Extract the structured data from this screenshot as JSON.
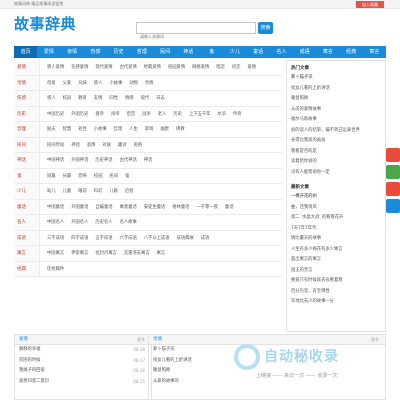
{
  "topbar": {
    "text": "故事词典 精品故事阅读鉴赏",
    "join": "加入收藏"
  },
  "logo": "故事辞典",
  "search": {
    "placeholder": "请输入关键词",
    "button": "搜索"
  },
  "nav": [
    "首页",
    "爱情",
    "亲情",
    "伤感",
    "历史",
    "哲理",
    "民间",
    "神话",
    "鬼",
    "少儿",
    "童话",
    "名人",
    "成语",
    "寓言",
    "经典",
    "寓言"
  ],
  "categories": [
    {
      "title": "爱情",
      "color": "#c0392b",
      "links": [
        "感人爱情",
        "伤感爱情",
        "现代爱情",
        "古代爱情",
        "经典爱情",
        "校园爱情",
        "网络爱情",
        "暗恋",
        "初恋",
        "爱情"
      ]
    },
    {
      "title": "亲情",
      "color": "#c0392b",
      "links": [
        "母爱",
        "父爱",
        "兄妹",
        "感人",
        "小故事",
        "动物",
        "亲情"
      ]
    },
    {
      "title": "伤感",
      "color": "#c0392b",
      "links": [
        "感人",
        "校园",
        "教育",
        "友情",
        "同性",
        "情感",
        "现代",
        "日志"
      ]
    },
    {
      "title": "历史",
      "color": "#c0392b",
      "links": [
        "中国历史",
        "外国历史",
        "盘帝",
        "闲帝",
        "后宫",
        "战争",
        "老人",
        "历史",
        "上下五千年",
        "水浒",
        "传奇"
      ]
    },
    {
      "title": "哲理",
      "color": "#c0392b",
      "links": [
        "励志",
        "智慧",
        "处世",
        "小故事",
        "哲理",
        "人生",
        "职场",
        "幽默",
        "佛教"
      ]
    },
    {
      "title": "民间",
      "color": "#c0392b",
      "links": [
        "民间传说",
        "神话",
        "悲情",
        "对联",
        "趣诗",
        "民俗"
      ]
    },
    {
      "title": "神话",
      "color": "#c0392b",
      "links": [
        "中国神话",
        "外国神话",
        "历史神话",
        "古代神话",
        "神话"
      ]
    },
    {
      "title": "鬼",
      "color": "#c0392b",
      "links": [
        "短篇",
        "长篇",
        "恐怖",
        "校园",
        "民间",
        "鬼"
      ]
    },
    {
      "title": "少儿",
      "color": "#c0392b",
      "links": [
        "幼儿",
        "儿童",
        "睡前",
        "科幻",
        "儿歌",
        "启智"
      ]
    },
    {
      "title": "童话",
      "color": "#c0392b",
      "links": [
        "中国童话",
        "外国童话",
        "自编童话",
        "寓意童话",
        "安徒生童话",
        "格林童话",
        "一千零一夜",
        "童话"
      ]
    },
    {
      "title": "名人",
      "color": "#c0392b",
      "links": [
        "中国名人",
        "外国名人",
        "历史名人",
        "名人故事"
      ]
    },
    {
      "title": "成语",
      "color": "#c0392b",
      "links": [
        "三字成语",
        "四字成语",
        "五字成语",
        "六字成语",
        "八字以上成语",
        "成语典故",
        "成语"
      ]
    },
    {
      "title": "寓言",
      "color": "#c0392b",
      "links": [
        "中国寓言",
        "伊索寓言",
        "拉封丹寓言",
        "克雷洛夫寓言",
        "寓言"
      ]
    },
    {
      "title": "经典",
      "color": "#c0392b",
      "links": [
        "优秀稿件"
      ]
    }
  ],
  "side": {
    "hot_title": "热门文章",
    "hot": [
      "萝卜猫子讯",
      "找女儿看的上奶讲话",
      "睡鼠照顾",
      "从前的爱情故事",
      "福尔马斯故事",
      "丽的读人的结束，骗不到已远离世界",
      "长得比我高的画画",
      "看看是否的是",
      "读着给你说的",
      "没有人能帮助你一定"
    ],
    "new_title": "最新文章",
    "new": [
      "一棵开花的树",
      "曲，还我清风",
      "第二 '水晶大战' 的看看花开",
      "7天7年7年代",
      "情比量天的故事",
      "人生有多少梅花有多少寓言",
      "超出寓言的寓言",
      "国王的宣言",
      "要爱只有时候就去会看着寒",
      "后分包里，有宝佛性",
      "军地比去少的故事一分"
    ]
  },
  "bottom_left": {
    "title": "爱情",
    "more": "更多",
    "items": [
      {
        "t": "静静的幸福",
        "n": "08-18"
      },
      {
        "t": "贫困的时候",
        "n": "08-17"
      },
      {
        "t": "我摊子的回家",
        "n": "08-16"
      },
      {
        "t": "爱想归第二意识",
        "n": "08-15"
      }
    ]
  },
  "bottom_right": {
    "title": "亲情",
    "more": "更多",
    "items": [
      {
        "t": "萝卜猫子讯",
        "n": ""
      },
      {
        "t": "找女儿看的上奶讲话",
        "n": ""
      },
      {
        "t": "睡鼠照顾",
        "n": ""
      },
      {
        "t": "从爱的故事的",
        "n": ""
      }
    ]
  },
  "watermark": {
    "big": "自动秘收录",
    "small": "上链接 —— 来访一次 —— 收录一次"
  },
  "colors": {
    "accent": "#1a8bd8",
    "join": "#e9524b"
  }
}
